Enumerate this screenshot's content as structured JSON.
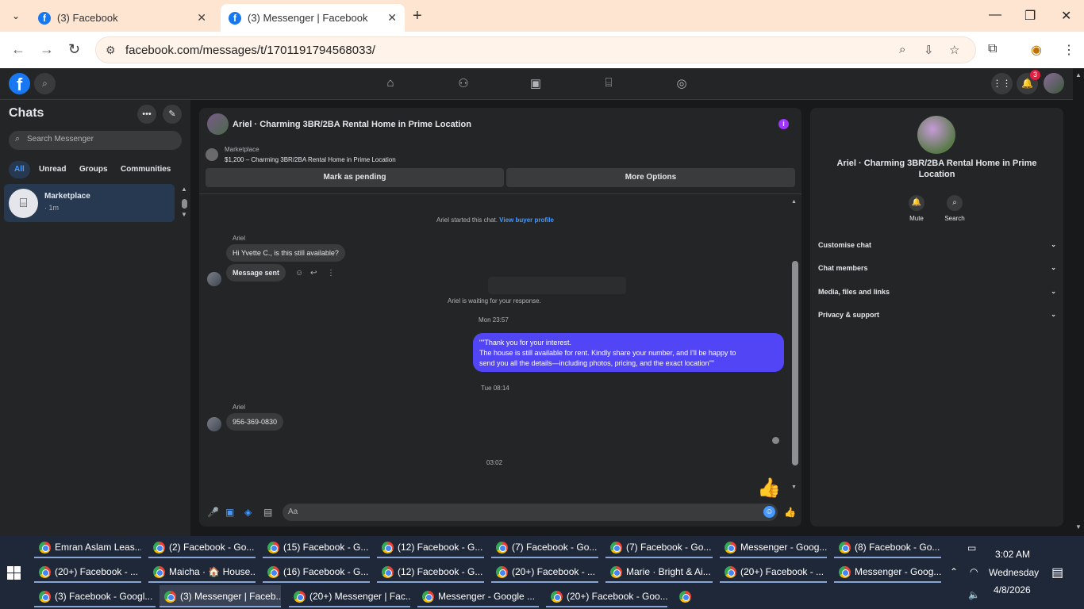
{
  "browser": {
    "tabs": [
      {
        "title": "(3) Facebook",
        "active": false
      },
      {
        "title": "(3) Messenger | Facebook",
        "active": true
      }
    ],
    "url": "facebook.com/messages/t/1701191794568033/"
  },
  "fb_header": {
    "notification_count": "3"
  },
  "sidebar": {
    "title": "Chats",
    "search_placeholder": "Search Messenger",
    "filters": [
      "All",
      "Unread",
      "Groups",
      "Communities"
    ],
    "active_filter": "All",
    "chats": [
      {
        "name": "Marketplace",
        "sub": "· 1m"
      }
    ]
  },
  "conversation": {
    "title": "Ariel · Charming 3BR/2BA Rental Home in Prime Location",
    "marketplace_label": "Marketplace",
    "listing": "$1,200 – Charming 3BR/2BA Rental Home in Prime Location",
    "buttons": {
      "pending": "Mark as pending",
      "more": "More Options"
    },
    "started_text": "Ariel started this chat.",
    "view_buyer_link": "View buyer profile",
    "sender1": "Ariel",
    "msg1": "Hi Yvette C., is this still available?",
    "msg2": "Message sent",
    "waiting_text": "Ariel is waiting for your response.",
    "time1": "Mon 23:57",
    "outgoing_line1": "\"\"Thank you for your interest.",
    "outgoing_line2": "The house is still available for rent. Kindly share your number, and I'll be happy to",
    "outgoing_line3": "send you all the details—including photos, pricing, and the exact location\"\"",
    "time2": "Tue 08:14",
    "sender2": "Ariel",
    "msg3": "956-369-0830",
    "time3": "03:02",
    "composer_placeholder": "Aa"
  },
  "info_panel": {
    "title": "Ariel · Charming 3BR/2BA Rental Home in Prime Location",
    "mute_label": "Mute",
    "search_label": "Search",
    "rows": [
      "Customise chat",
      "Chat members",
      "Media, files and links",
      "Privacy & support"
    ]
  },
  "taskbar": {
    "items": [
      "Emran Aslam Leas...",
      "(2) Facebook - Go...",
      "(15) Facebook - G...",
      "(12) Facebook - G...",
      "(7) Facebook - Go...",
      "(7) Facebook - Go...",
      "Messenger - Goog...",
      "(8) Facebook - Go...",
      "(20+) Facebook - ...",
      "Maicha · 🏠 House...",
      "(16) Facebook - G...",
      "(12) Facebook - G...",
      "(20+) Facebook - ...",
      "Marie · Bright & Ai...",
      "(20+) Facebook - ...",
      "Messenger - Goog...",
      "(3) Facebook - Googl...",
      "(3) Messenger | Faceb...",
      "(20+) Messenger | Fac...",
      "Messenger - Google ...",
      "(20+) Facebook - Goo..."
    ],
    "active_index": 17,
    "time": "3:02 AM",
    "day": "Wednesday",
    "date": "4/8/2026"
  }
}
